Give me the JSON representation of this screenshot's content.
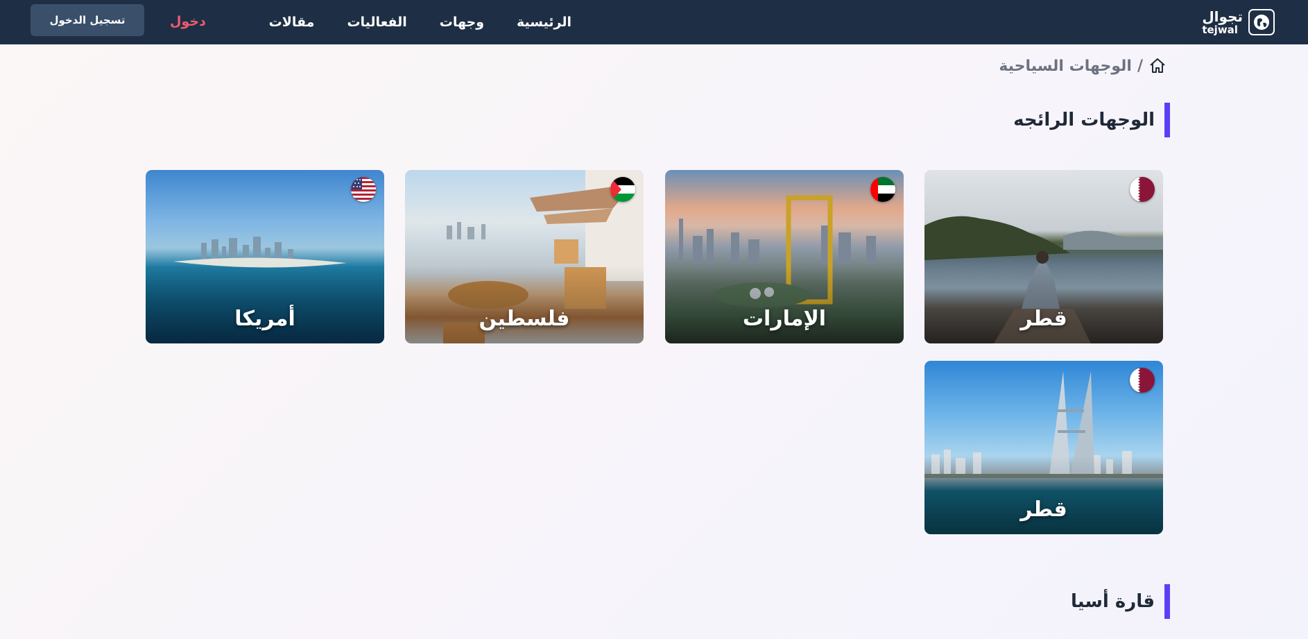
{
  "nav": {
    "logo_ar": "تجوال",
    "logo_en": "tejwal",
    "links": [
      "الرئيسية",
      "وجهات",
      "الفعاليات",
      "مقالات"
    ],
    "login": "دخول",
    "signup": "تسجيل الدخول"
  },
  "breadcrumb": {
    "separator": "/",
    "current": "الوجهات السياحية"
  },
  "sections": {
    "trending": "الوجهات الرائجه",
    "asia": "قارة أسيا"
  },
  "cards": [
    {
      "label": "قطر",
      "flag": "qatar-flag-icon"
    },
    {
      "label": "الإمارات",
      "flag": "uae-flag-icon"
    },
    {
      "label": "فلسطين",
      "flag": "palestine-flag-icon"
    },
    {
      "label": "أمريكا",
      "flag": "usa-flag-icon"
    },
    {
      "label": "قطر",
      "flag": "qatar-flag-icon"
    }
  ],
  "colors": {
    "navbar": "#1e2f45",
    "accent_bar": "#5b3ff6",
    "login": "#ef5b6c",
    "signup_button": "#3a4f6a"
  }
}
